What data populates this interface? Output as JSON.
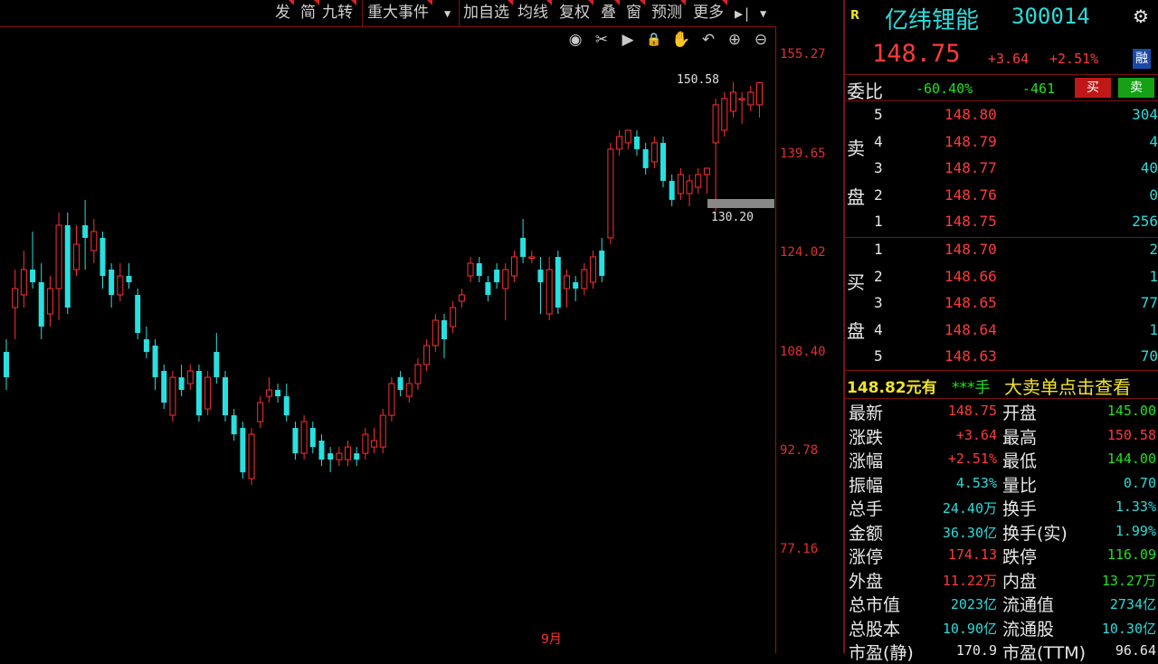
{
  "toolbar": {
    "items": [
      "发",
      "简",
      "九转",
      "重大事件",
      "加自选",
      "均线",
      "复权",
      "叠",
      "窗",
      "预测",
      "更多"
    ],
    "dropdown_glyph": "▼",
    "goto_glyph": "▶|"
  },
  "tools": [
    "eye-icon",
    "scissors-icon",
    "play-icon",
    "lock-icon",
    "hand-icon",
    "undo-icon",
    "zoom-in-icon",
    "zoom-out-icon"
  ],
  "tool_glyphs": [
    "◉",
    "✂",
    "▶",
    "🔒",
    "✋",
    "↶",
    "⊕",
    "⊖"
  ],
  "axis": {
    "labels": [
      "155.27",
      "139.65",
      "124.02",
      "108.40",
      "92.78",
      "77.16"
    ]
  },
  "chart_data": {
    "type": "candlestick",
    "ylim": [
      77.16,
      155.27
    ],
    "high_label": "150.58",
    "low_label": "130.20",
    "date_mark": "9月",
    "candles": [
      {
        "o": 108,
        "c": 104,
        "h": 110,
        "l": 102
      },
      {
        "o": 115,
        "c": 118,
        "h": 121,
        "l": 110
      },
      {
        "o": 117,
        "c": 121,
        "h": 124,
        "l": 115
      },
      {
        "o": 121,
        "c": 119,
        "h": 127,
        "l": 118
      },
      {
        "o": 119,
        "c": 112,
        "h": 122,
        "l": 110
      },
      {
        "o": 114,
        "c": 118,
        "h": 120,
        "l": 112
      },
      {
        "o": 118,
        "c": 128,
        "h": 130,
        "l": 113
      },
      {
        "o": 128,
        "c": 115,
        "h": 130,
        "l": 114
      },
      {
        "o": 121,
        "c": 125,
        "h": 128,
        "l": 120
      },
      {
        "o": 128,
        "c": 126,
        "h": 132,
        "l": 121
      },
      {
        "o": 124,
        "c": 127,
        "h": 129,
        "l": 122
      },
      {
        "o": 126,
        "c": 120,
        "h": 127,
        "l": 118
      },
      {
        "o": 121,
        "c": 117,
        "h": 122,
        "l": 115
      },
      {
        "o": 117,
        "c": 120,
        "h": 122,
        "l": 116
      },
      {
        "o": 120,
        "c": 119,
        "h": 122,
        "l": 118
      },
      {
        "o": 117,
        "c": 111,
        "h": 118,
        "l": 110
      },
      {
        "o": 110,
        "c": 108,
        "h": 112,
        "l": 107
      },
      {
        "o": 109,
        "c": 104,
        "h": 110,
        "l": 102
      },
      {
        "o": 105,
        "c": 100,
        "h": 106,
        "l": 99
      },
      {
        "o": 98,
        "c": 104,
        "h": 105,
        "l": 97
      },
      {
        "o": 104,
        "c": 102,
        "h": 106,
        "l": 101
      },
      {
        "o": 103,
        "c": 105,
        "h": 106,
        "l": 102
      },
      {
        "o": 105,
        "c": 98,
        "h": 106,
        "l": 97
      },
      {
        "o": 99,
        "c": 104,
        "h": 105,
        "l": 98
      },
      {
        "o": 108,
        "c": 104,
        "h": 111,
        "l": 103
      },
      {
        "o": 104,
        "c": 98,
        "h": 105,
        "l": 97
      },
      {
        "o": 98,
        "c": 95,
        "h": 99,
        "l": 94
      },
      {
        "o": 96,
        "c": 89,
        "h": 97,
        "l": 88
      },
      {
        "o": 88,
        "c": 95,
        "h": 96,
        "l": 87
      },
      {
        "o": 97,
        "c": 100,
        "h": 101,
        "l": 96
      },
      {
        "o": 101,
        "c": 102,
        "h": 104,
        "l": 100
      },
      {
        "o": 102,
        "c": 101,
        "h": 103,
        "l": 100
      },
      {
        "o": 101,
        "c": 98,
        "h": 103,
        "l": 97
      },
      {
        "o": 96,
        "c": 92,
        "h": 97,
        "l": 91
      },
      {
        "o": 92,
        "c": 97,
        "h": 98,
        "l": 91
      },
      {
        "o": 96,
        "c": 93,
        "h": 97,
        "l": 92
      },
      {
        "o": 94,
        "c": 91,
        "h": 95,
        "l": 90
      },
      {
        "o": 92,
        "c": 91,
        "h": 93,
        "l": 89
      },
      {
        "o": 91,
        "c": 92,
        "h": 93,
        "l": 90
      },
      {
        "o": 91,
        "c": 93,
        "h": 94,
        "l": 90
      },
      {
        "o": 92,
        "c": 91,
        "h": 93,
        "l": 90
      },
      {
        "o": 92,
        "c": 95,
        "h": 96,
        "l": 91
      },
      {
        "o": 93,
        "c": 94,
        "h": 96,
        "l": 92
      },
      {
        "o": 93,
        "c": 98,
        "h": 99,
        "l": 92
      },
      {
        "o": 98,
        "c": 103,
        "h": 104,
        "l": 97
      },
      {
        "o": 104,
        "c": 102,
        "h": 105,
        "l": 101
      },
      {
        "o": 101,
        "c": 103,
        "h": 104,
        "l": 100
      },
      {
        "o": 103,
        "c": 106,
        "h": 107,
        "l": 102
      },
      {
        "o": 106,
        "c": 109,
        "h": 110,
        "l": 105
      },
      {
        "o": 109,
        "c": 113,
        "h": 114,
        "l": 108
      },
      {
        "o": 113,
        "c": 110,
        "h": 114,
        "l": 107
      },
      {
        "o": 112,
        "c": 115,
        "h": 116,
        "l": 111
      },
      {
        "o": 116,
        "c": 117,
        "h": 118,
        "l": 115
      },
      {
        "o": 120,
        "c": 122,
        "h": 123,
        "l": 119
      },
      {
        "o": 122,
        "c": 120,
        "h": 123,
        "l": 119
      },
      {
        "o": 119,
        "c": 117,
        "h": 120,
        "l": 116
      },
      {
        "o": 121,
        "c": 119,
        "h": 122,
        "l": 118
      },
      {
        "o": 118,
        "c": 121,
        "h": 122,
        "l": 113
      },
      {
        "o": 120,
        "c": 123,
        "h": 124,
        "l": 119
      },
      {
        "o": 126,
        "c": 123,
        "h": 129,
        "l": 122
      },
      {
        "o": 123,
        "c": 123,
        "h": 124,
        "l": 122
      },
      {
        "o": 121,
        "c": 119,
        "h": 123,
        "l": 114
      },
      {
        "o": 114,
        "c": 121,
        "h": 123,
        "l": 113
      },
      {
        "o": 123,
        "c": 115,
        "h": 124,
        "l": 114
      },
      {
        "o": 118,
        "c": 120,
        "h": 121,
        "l": 115
      },
      {
        "o": 119,
        "c": 118,
        "h": 120,
        "l": 116
      },
      {
        "o": 118,
        "c": 121,
        "h": 122,
        "l": 117
      },
      {
        "o": 119,
        "c": 123,
        "h": 124,
        "l": 118
      },
      {
        "o": 124,
        "c": 120,
        "h": 126,
        "l": 119
      },
      {
        "o": 126,
        "c": 140,
        "h": 141,
        "l": 125
      },
      {
        "o": 140,
        "c": 142,
        "h": 143,
        "l": 139
      },
      {
        "o": 141,
        "c": 143,
        "h": 143,
        "l": 140
      },
      {
        "o": 142,
        "c": 140,
        "h": 143,
        "l": 139
      },
      {
        "o": 140,
        "c": 137,
        "h": 141,
        "l": 136
      },
      {
        "o": 138,
        "c": 141,
        "h": 142,
        "l": 137
      },
      {
        "o": 141,
        "c": 135,
        "h": 142,
        "l": 134
      },
      {
        "o": 135,
        "c": 132,
        "h": 136,
        "l": 131
      },
      {
        "o": 133,
        "c": 136,
        "h": 137,
        "l": 132
      },
      {
        "o": 133,
        "c": 135,
        "h": 136,
        "l": 131
      },
      {
        "o": 134,
        "c": 136,
        "h": 137,
        "l": 133
      },
      {
        "o": 136,
        "c": 137,
        "h": 137,
        "l": 133
      },
      {
        "o": 141,
        "c": 147,
        "h": 148,
        "l": 130.2
      },
      {
        "o": 143,
        "c": 148,
        "h": 149,
        "l": 142
      },
      {
        "o": 146,
        "c": 149,
        "h": 150.58,
        "l": 145
      },
      {
        "o": 148,
        "c": 148,
        "h": 149,
        "l": 144
      },
      {
        "o": 147,
        "c": 149,
        "h": 150,
        "l": 146
      },
      {
        "o": 147,
        "c": 150.5,
        "h": 150.58,
        "l": 145
      }
    ]
  },
  "quote": {
    "name": "亿纬锂能",
    "code": "300014",
    "r_badge": "R",
    "price": "148.75",
    "change": "+3.64",
    "change_pct": "+2.51%",
    "rong_badge": "融",
    "weibi_label": "委比",
    "weibi_pct": "-60.40%",
    "weicha": "-461",
    "buy_btn": "买",
    "sell_btn": "卖",
    "sell_side": [
      "卖",
      "盘"
    ],
    "buy_side": [
      "买",
      "盘"
    ],
    "asks": [
      {
        "lvl": "5",
        "price": "148.80",
        "vol": "304"
      },
      {
        "lvl": "4",
        "price": "148.79",
        "vol": "4"
      },
      {
        "lvl": "3",
        "price": "148.77",
        "vol": "40"
      },
      {
        "lvl": "2",
        "price": "148.76",
        "vol": "0"
      },
      {
        "lvl": "1",
        "price": "148.75",
        "vol": "256"
      }
    ],
    "bids": [
      {
        "lvl": "1",
        "price": "148.70",
        "vol": "2"
      },
      {
        "lvl": "2",
        "price": "148.66",
        "vol": "1"
      },
      {
        "lvl": "3",
        "price": "148.65",
        "vol": "77"
      },
      {
        "lvl": "4",
        "price": "148.64",
        "vol": "1"
      },
      {
        "lvl": "5",
        "price": "148.63",
        "vol": "70"
      }
    ],
    "banner_left": "148.82元有",
    "banner_mid": "***手",
    "banner_right": "大卖单点击查看",
    "stats": [
      {
        "l1": "最新",
        "v1": "148.75",
        "c1": "red",
        "l2": "开盘",
        "v2": "145.00",
        "c2": "green"
      },
      {
        "l1": "涨跌",
        "v1": "+3.64",
        "c1": "red",
        "l2": "最高",
        "v2": "150.58",
        "c2": "red"
      },
      {
        "l1": "涨幅",
        "v1": "+2.51%",
        "c1": "red",
        "l2": "最低",
        "v2": "144.00",
        "c2": "green"
      },
      {
        "l1": "振幅",
        "v1": "4.53%",
        "c1": "cyan",
        "l2": "量比",
        "v2": "0.70",
        "c2": "cyan"
      },
      {
        "l1": "总手",
        "v1": "24.40万",
        "c1": "cyan",
        "l2": "换手",
        "v2": "1.33%",
        "c2": "cyan"
      },
      {
        "l1": "金额",
        "v1": "36.30亿",
        "c1": "cyan",
        "l2": "换手(实)",
        "v2": "1.99%",
        "c2": "cyan"
      },
      {
        "l1": "涨停",
        "v1": "174.13",
        "c1": "red",
        "l2": "跌停",
        "v2": "116.09",
        "c2": "green"
      },
      {
        "l1": "外盘",
        "v1": "11.22万",
        "c1": "red",
        "l2": "内盘",
        "v2": "13.27万",
        "c2": "green"
      },
      {
        "l1": "总市值",
        "v1": "2023亿",
        "c1": "cyan",
        "l2": "流通值",
        "v2": "2734亿",
        "c2": "cyan"
      },
      {
        "l1": "总股本",
        "v1": "10.90亿",
        "c1": "cyan",
        "l2": "流通股",
        "v2": "10.30亿",
        "c2": "cyan"
      },
      {
        "l1": "市盈(静)",
        "v1": "170.9",
        "c1": "white",
        "l2": "市盈(TTM)",
        "v2": "96.64",
        "c2": "white"
      }
    ],
    "gear_glyph": "⚙"
  },
  "colors": {
    "up": "#ff3030",
    "down": "#28e0e0",
    "axis": "#e03030"
  }
}
